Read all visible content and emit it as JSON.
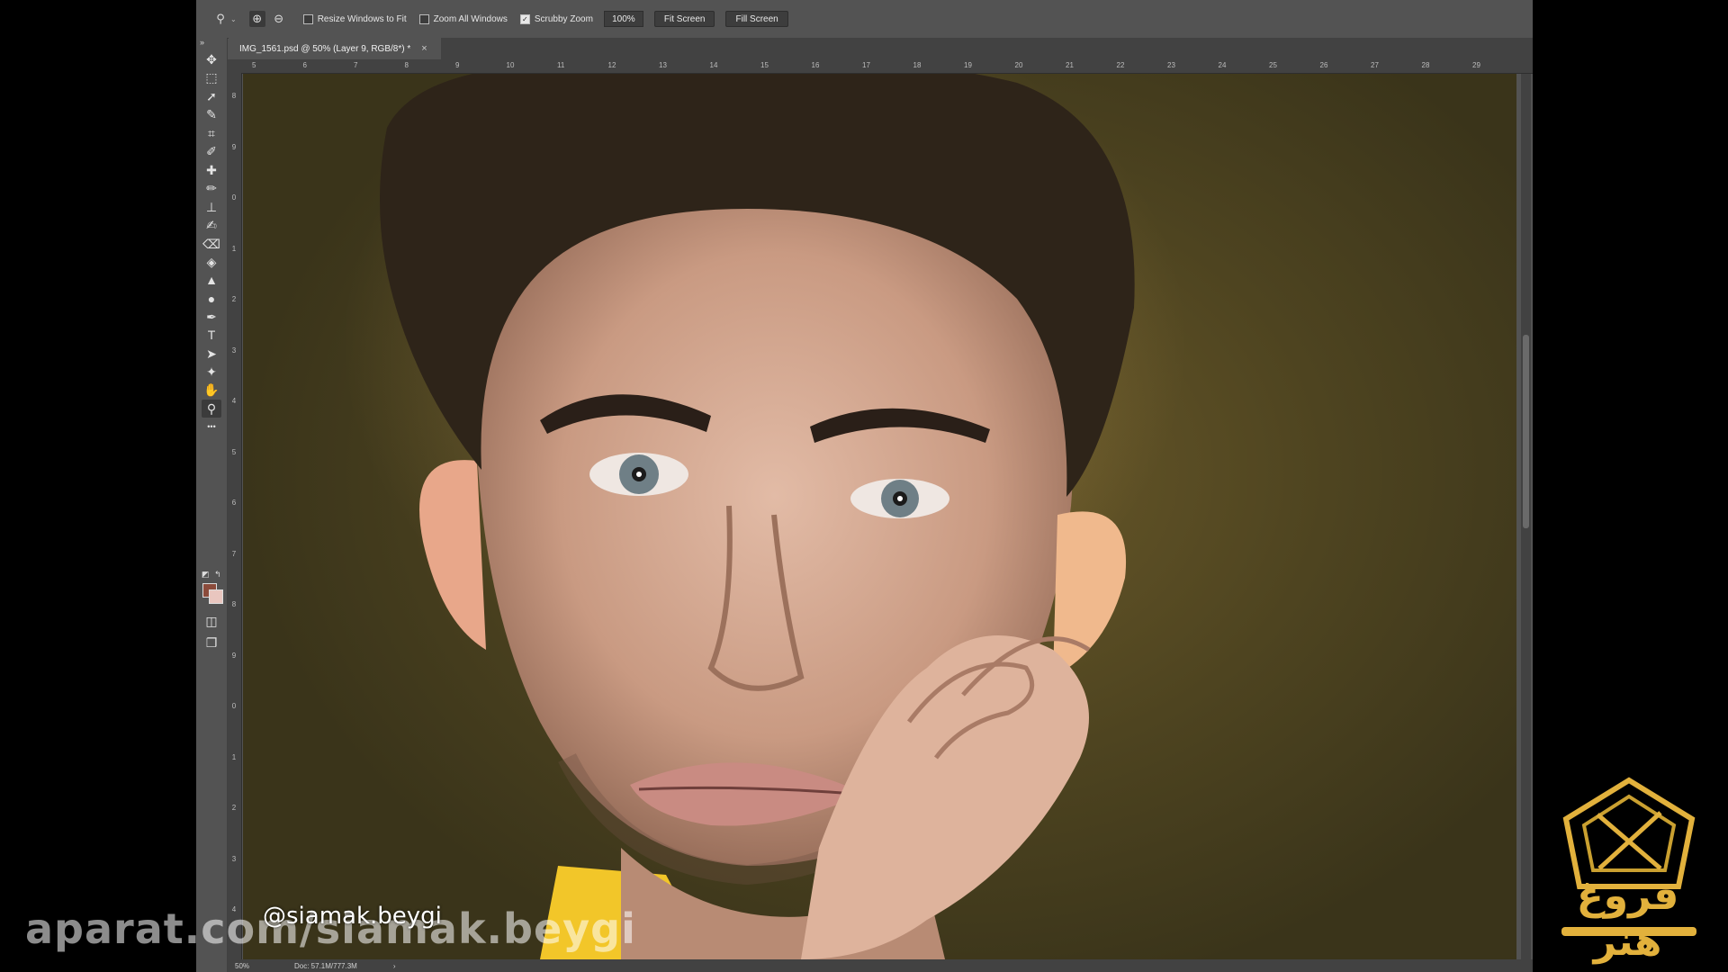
{
  "options_bar": {
    "tool_icon": "zoom-icon",
    "zoom_in_icon": "zoom-in-icon",
    "zoom_out_icon": "zoom-out-icon",
    "resize_windows_label": "Resize Windows to Fit",
    "resize_windows_checked": false,
    "zoom_all_windows_label": "Zoom All Windows",
    "zoom_all_windows_checked": false,
    "scrubby_zoom_label": "Scrubby Zoom",
    "scrubby_zoom_checked": true,
    "zoom_value": "100%",
    "fit_screen_label": "Fit Screen",
    "fill_screen_label": "Fill Screen"
  },
  "document_tab": {
    "title": "IMG_1561.psd @ 50% (Layer 9, RGB/8*) *",
    "close_glyph": "×"
  },
  "toolbar": {
    "collapse_glyph": "»",
    "tools": [
      {
        "name": "move-tool",
        "glyph": "✥"
      },
      {
        "name": "rectangular-marquee-tool",
        "glyph": "⬚"
      },
      {
        "name": "lasso-tool",
        "glyph": "➚"
      },
      {
        "name": "quick-selection-tool",
        "glyph": "✎"
      },
      {
        "name": "crop-tool",
        "glyph": "⌗"
      },
      {
        "name": "eyedropper-tool",
        "glyph": "✐"
      },
      {
        "name": "spot-healing-tool",
        "glyph": "✚"
      },
      {
        "name": "brush-tool",
        "glyph": "✏"
      },
      {
        "name": "clone-stamp-tool",
        "glyph": "⊥"
      },
      {
        "name": "history-brush-tool",
        "glyph": "✍"
      },
      {
        "name": "eraser-tool",
        "glyph": "⌫"
      },
      {
        "name": "paint-bucket-tool",
        "glyph": "◈"
      },
      {
        "name": "sharpen-tool",
        "glyph": "▲"
      },
      {
        "name": "dodge-tool",
        "glyph": "●"
      },
      {
        "name": "pen-tool",
        "glyph": "✒"
      },
      {
        "name": "type-tool",
        "glyph": "T"
      },
      {
        "name": "path-selection-tool",
        "glyph": "➤"
      },
      {
        "name": "custom-shape-tool",
        "glyph": "✦"
      },
      {
        "name": "hand-tool",
        "glyph": "✋"
      },
      {
        "name": "zoom-tool",
        "glyph": "⚲"
      },
      {
        "name": "edit-toolbar",
        "glyph": "•••"
      }
    ],
    "foreground_color": "#8b4b3b",
    "background_color": "#e9c6bf",
    "quick-mask-glyph": "◫",
    "screen-mode-glyph": "❐"
  },
  "ruler_top": [
    "5",
    "6",
    "7",
    "8",
    "9",
    "10",
    "11",
    "12",
    "13",
    "14",
    "15",
    "16",
    "17",
    "18",
    "19",
    "20",
    "21",
    "22",
    "23",
    "24",
    "25",
    "26",
    "27",
    "28",
    "29"
  ],
  "ruler_left": [
    "8",
    "9",
    "0",
    "1",
    "2",
    "3",
    "4",
    "5",
    "6",
    "7",
    "8",
    "9",
    "0",
    "1",
    "2",
    "3",
    "4"
  ],
  "status_bar": {
    "zoom": "50%",
    "doc_info": "Doc: 57.1M/777.3M",
    "arrow": "›"
  },
  "overlays": {
    "site_watermark": "aparat.com/siamak.beygi",
    "handle": "@siamak.beygi",
    "logo_text": "فروغ هنر"
  },
  "colors": {
    "ui_bg": "#535353",
    "panel_dark": "#424242",
    "logo_gold": "#e2b13c"
  }
}
